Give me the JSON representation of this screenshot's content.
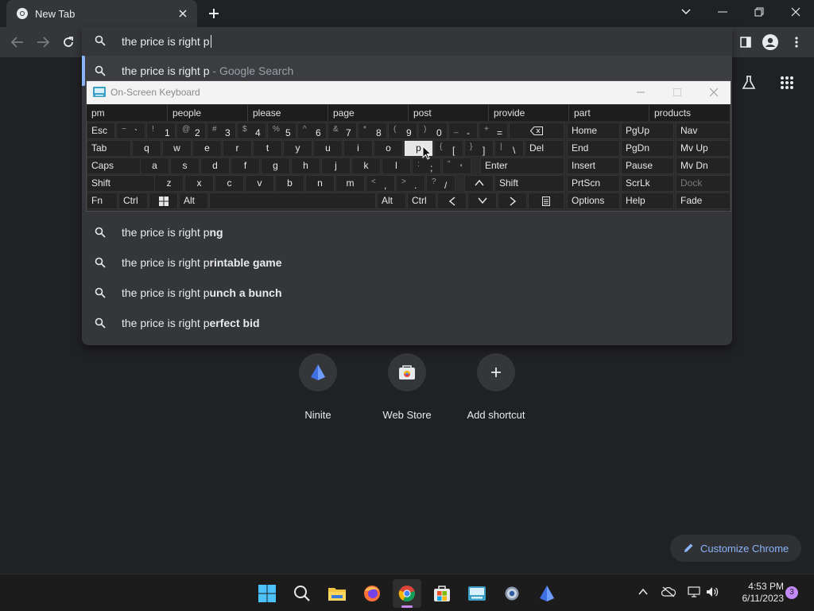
{
  "tab": {
    "title": "New Tab"
  },
  "omnibox": {
    "input_value": "the price is right p",
    "top_suggestion": {
      "prefix": "the price is right p",
      "suffix": " - Google Search"
    },
    "suggestions": [
      {
        "prefix": "the price is right p",
        "bold": "ng"
      },
      {
        "prefix": "the price is right p",
        "bold": "rintable game"
      },
      {
        "prefix": "the price is right p",
        "bold": "unch a bunch"
      },
      {
        "prefix": "the price is right p",
        "bold": "erfect bid"
      }
    ]
  },
  "osk": {
    "title": "On-Screen Keyboard",
    "predictions": [
      "pm",
      "people",
      "please",
      "page",
      "post",
      "provide",
      "part",
      "products"
    ],
    "keys": {
      "esc": "Esc",
      "tab": "Tab",
      "caps": "Caps",
      "shift_left": "Shift",
      "shift_right": "Shift",
      "fn": "Fn",
      "ctrl_left": "Ctrl",
      "alt_left": "Alt",
      "alt_right": "Alt",
      "ctrl_right": "Ctrl",
      "del": "Del",
      "enter": "Enter",
      "home": "Home",
      "pgup": "PgUp",
      "nav": "Nav",
      "end": "End",
      "pgdn": "PgDn",
      "mvup": "Mv Up",
      "insert": "Insert",
      "pause": "Pause",
      "mvdn": "Mv Dn",
      "prtscn": "PrtScn",
      "scrlk": "ScrLk",
      "dock": "Dock",
      "options": "Options",
      "help": "Help",
      "fade": "Fade",
      "num_row": [
        {
          "sup": "~",
          "main": "`"
        },
        {
          "sup": "!",
          "main": "1"
        },
        {
          "sup": "@",
          "main": "2"
        },
        {
          "sup": "#",
          "main": "3"
        },
        {
          "sup": "$",
          "main": "4"
        },
        {
          "sup": "%",
          "main": "5"
        },
        {
          "sup": "^",
          "main": "6"
        },
        {
          "sup": "&",
          "main": "7"
        },
        {
          "sup": "*",
          "main": "8"
        },
        {
          "sup": "(",
          "main": "9"
        },
        {
          "sup": ")",
          "main": "0"
        },
        {
          "sup": "_",
          "main": "-"
        },
        {
          "sup": "+",
          "main": "="
        }
      ],
      "row_q": [
        "q",
        "w",
        "e",
        "r",
        "t",
        "y",
        "u",
        "i",
        "o",
        "p"
      ],
      "row_q_extra": [
        {
          "sup": "{",
          "main": "["
        },
        {
          "sup": "}",
          "main": "]"
        },
        {
          "sup": "|",
          "main": "\\"
        }
      ],
      "row_a": [
        "a",
        "s",
        "d",
        "f",
        "g",
        "h",
        "j",
        "k",
        "l"
      ],
      "row_a_extra": [
        {
          "sup": ":",
          "main": ";"
        },
        {
          "sup": "\"",
          "main": "'"
        }
      ],
      "row_z": [
        "z",
        "x",
        "c",
        "v",
        "b",
        "n",
        "m"
      ],
      "row_z_extra": [
        {
          "sup": "<",
          "main": ","
        },
        {
          "sup": ">",
          "main": "."
        },
        {
          "sup": "?",
          "main": "/"
        }
      ]
    }
  },
  "shortcuts": [
    {
      "label": "Ninite"
    },
    {
      "label": "Web Store"
    },
    {
      "label": "Add shortcut"
    }
  ],
  "customize": {
    "label": "Customize Chrome"
  },
  "taskbar": {
    "time": "4:53 PM",
    "date": "6/11/2023",
    "notification_count": "3"
  },
  "colors": {
    "accent": "#8ab4f8",
    "frame": "#202124",
    "toolbar": "#35363a",
    "taskbar": "#1c1c1c"
  }
}
